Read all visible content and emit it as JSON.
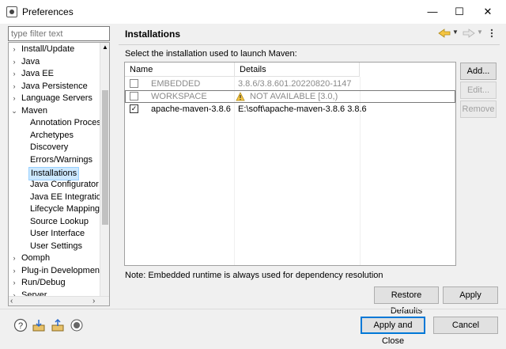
{
  "window": {
    "title": "Preferences",
    "controls": {
      "minimize": "—",
      "maximize": "☐",
      "close": "✕"
    }
  },
  "filter": {
    "placeholder": "type filter text"
  },
  "tree": {
    "items": [
      {
        "label": "Install/Update",
        "expander": "›",
        "level": 0
      },
      {
        "label": "Java",
        "expander": "›",
        "level": 0
      },
      {
        "label": "Java EE",
        "expander": "›",
        "level": 0
      },
      {
        "label": "Java Persistence",
        "expander": "›",
        "level": 0
      },
      {
        "label": "Language Servers",
        "expander": "›",
        "level": 0
      },
      {
        "label": "Maven",
        "expander": "⌄",
        "level": 0
      },
      {
        "label": "Annotation Process",
        "level": 1
      },
      {
        "label": "Archetypes",
        "level": 1
      },
      {
        "label": "Discovery",
        "level": 1
      },
      {
        "label": "Errors/Warnings",
        "level": 1
      },
      {
        "label": "Installations",
        "level": 1,
        "selected": true
      },
      {
        "label": "Java Configurator",
        "level": 1
      },
      {
        "label": "Java EE Integration",
        "level": 1
      },
      {
        "label": "Lifecycle Mappings",
        "level": 1
      },
      {
        "label": "Source Lookup",
        "level": 1
      },
      {
        "label": "User Interface",
        "level": 1
      },
      {
        "label": "User Settings",
        "level": 1
      },
      {
        "label": "Oomph",
        "expander": "›",
        "level": 0
      },
      {
        "label": "Plug-in Development",
        "expander": "›",
        "level": 0
      },
      {
        "label": "Run/Debug",
        "expander": "›",
        "level": 0
      },
      {
        "label": "Server",
        "expander": "›",
        "level": 0
      }
    ]
  },
  "page": {
    "title": "Installations",
    "description": "Select the installation used to launch Maven:",
    "columns": {
      "name": "Name",
      "details": "Details"
    },
    "rows": [
      {
        "name": "EMBEDDED",
        "details": "3.8.6/3.8.601.20220820-1147",
        "checked": false,
        "gray": true,
        "warning": false
      },
      {
        "name": "WORKSPACE",
        "details": "NOT AVAILABLE [3.0,)",
        "checked": false,
        "gray": true,
        "warning": true
      },
      {
        "name": "apache-maven-3.8.6",
        "details": "E:\\soft\\apache-maven-3.8.6 3.8.6",
        "checked": true,
        "gray": false,
        "warning": false
      }
    ],
    "side_buttons": {
      "add": "Add...",
      "edit": "Edit...",
      "remove": "Remove"
    },
    "note": "Note: Embedded runtime is always used for dependency resolution",
    "restore_defaults": "Restore Defaults",
    "apply": "Apply"
  },
  "footer": {
    "apply_close": "Apply and Close",
    "cancel": "Cancel"
  },
  "icons": {
    "back": "arrow-left-icon",
    "forward": "arrow-right-icon",
    "menu": "view-menu-icon"
  }
}
